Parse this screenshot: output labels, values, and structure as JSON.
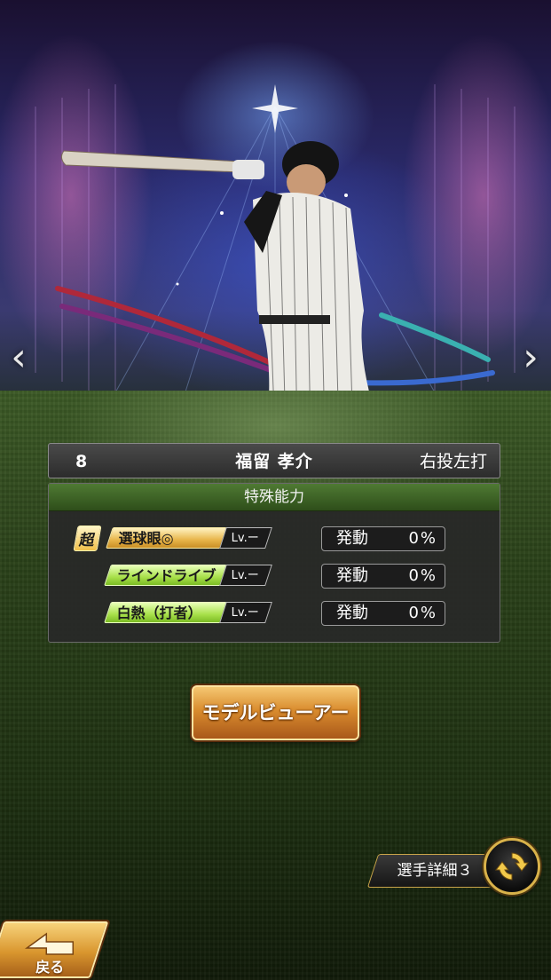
{
  "player": {
    "number": "8",
    "name": "福留 孝介",
    "handedness": "右投左打"
  },
  "abilities": {
    "header": "特殊能力",
    "rows": [
      {
        "super_mark": "超",
        "name": "選球眼◎",
        "level": "Lv.ー",
        "activation_label": "発動",
        "activation_rate": "0%",
        "tag_color": "#e8b54a"
      },
      {
        "super_mark": "",
        "name": "ラインドライブ",
        "level": "Lv.ー",
        "activation_label": "発動",
        "activation_rate": "0%",
        "tag_color": "#a8e04a"
      },
      {
        "super_mark": "",
        "name": "白熱（打者）",
        "level": "Lv.ー",
        "activation_label": "発動",
        "activation_rate": "0%",
        "tag_color": "#a8e04a"
      }
    ]
  },
  "buttons": {
    "model_viewer": "モデルビューアー",
    "player_detail": "選手詳細３",
    "back": "戻る"
  },
  "nav": {
    "prev": "‹",
    "next": "›"
  },
  "icons": {
    "back": "back-arrow-icon",
    "switch": "refresh-icon"
  },
  "colors": {
    "accent_gold": "#d9962e",
    "ability_green": "#2e4e1a"
  }
}
